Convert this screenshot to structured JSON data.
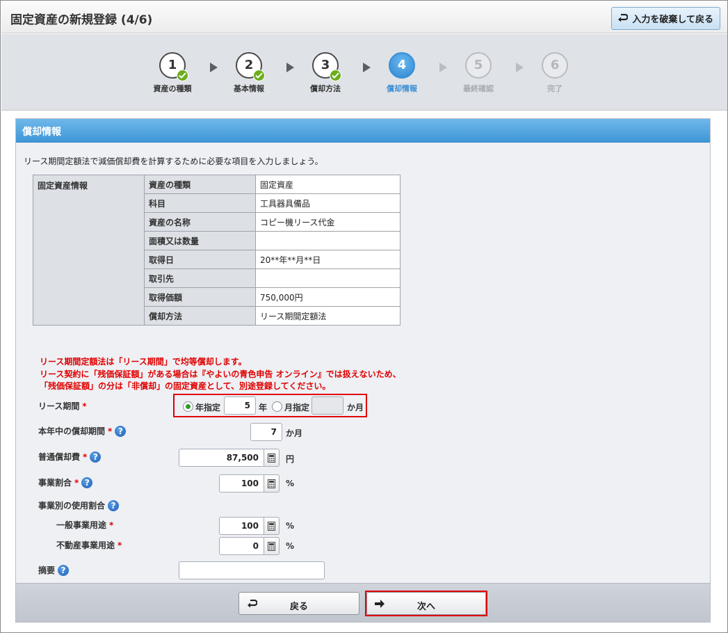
{
  "header": {
    "title": "固定資産の新規登録 (4/6)",
    "discard_label": "入力を破棄して戻る"
  },
  "steps": [
    {
      "num": "1",
      "label": "資産の種類",
      "state": "done"
    },
    {
      "num": "2",
      "label": "基本情報",
      "state": "done"
    },
    {
      "num": "3",
      "label": "償却方法",
      "state": "done"
    },
    {
      "num": "4",
      "label": "償却情報",
      "state": "active"
    },
    {
      "num": "5",
      "label": "最終確認",
      "state": "future"
    },
    {
      "num": "6",
      "label": "完了",
      "state": "future"
    }
  ],
  "panel": {
    "title": "償却情報",
    "intro": "リース期間定額法で減価償却費を計算するために必要な項目を入力しましょう。",
    "info_header": "固定資産情報",
    "rows": [
      {
        "label": "資産の種類",
        "value": "固定資産"
      },
      {
        "label": "科目",
        "value": "工具器具備品"
      },
      {
        "label": "資産の名称",
        "value": "コピー機リース代金"
      },
      {
        "label": "面積又は数量",
        "value": ""
      },
      {
        "label": "取得日",
        "value": "20**年**月**日"
      },
      {
        "label": "取引先",
        "value": ""
      },
      {
        "label": "取得価額",
        "value": "750,000円"
      },
      {
        "label": "償却方法",
        "value": "リース期間定額法"
      }
    ],
    "warnings": [
      "リース期間定額法は「リース期間」で均等償却します。",
      "リース契約に「残価保証額」がある場合は『やよいの青色申告 オンライン』では扱えないため、",
      "「残価保証額」の分は「非償却」の固定資産として、別途登録してください。"
    ]
  },
  "form": {
    "lease_label": "リース期間",
    "year_option": "年指定",
    "year_value": "5",
    "year_unit": "年",
    "month_option": "月指定",
    "month_value": "",
    "month_unit": "か月",
    "period_label": "本年中の償却期間",
    "period_value": "7",
    "period_unit": "か月",
    "normal_label": "普通償却費",
    "normal_value": "87,500",
    "normal_unit": "円",
    "biz_ratio_label": "事業割合",
    "biz_ratio_value": "100",
    "pct": "%",
    "use_ratio_label": "事業別の使用割合",
    "general_label": "一般事業用途",
    "general_value": "100",
    "realestate_label": "不動産事業用途",
    "realestate_value": "0",
    "memo_label": "摘要",
    "memo_value": "",
    "required_mark": "*",
    "help_mark": "?"
  },
  "footer": {
    "back_label": "戻る",
    "next_label": "次へ"
  },
  "colors": {
    "accent": "#3a8fd6",
    "warning": "#e00000",
    "check": "#6cad1d"
  }
}
